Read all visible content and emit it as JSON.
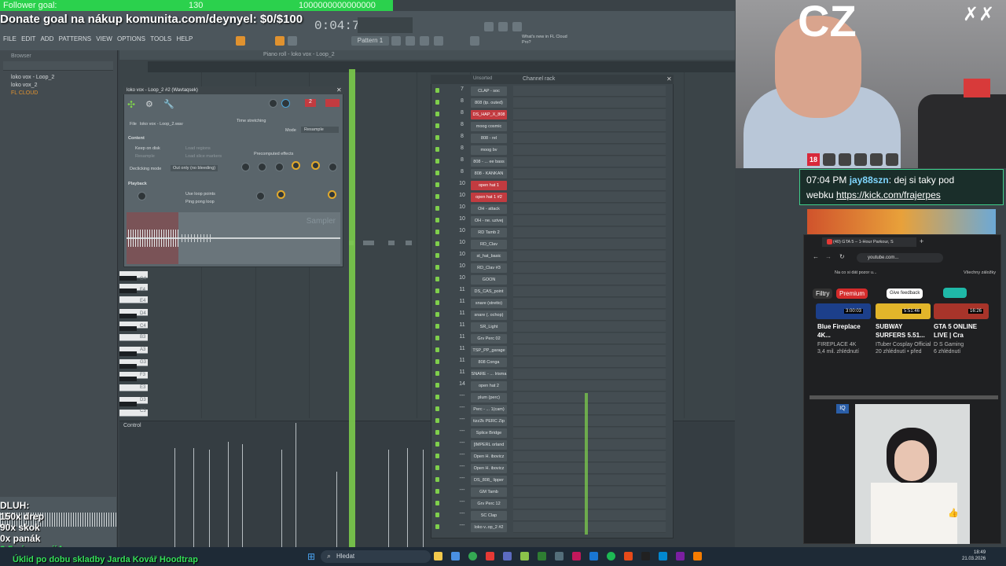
{
  "overlay": {
    "follower_goal_label": "Follower goal:",
    "follower_goal_current": "130",
    "follower_goal_target": "1000000000000000",
    "donate": "Donate goal na nákup komunita.com/deynyel: $0/$100"
  },
  "fl": {
    "menu": [
      "FILE",
      "EDIT",
      "ADD",
      "PATTERNS",
      "VIEW",
      "OPTIONS",
      "TOOLS",
      "HELP"
    ],
    "time": "0:04:76",
    "pattern": "Pattern 1",
    "hint": "What's new in FL Cloud Pro?",
    "browser_label": "Browser",
    "browser_items": [
      "loko vox - Loop_2",
      "loko vox_2",
      "FL CLOUD"
    ],
    "pianoroll_title": "Piano roll - loko vox - Loop_2",
    "control_label": "Control",
    "key_labels": [
      "G4",
      "F4",
      "E4",
      "D4",
      "C4",
      "B3",
      "A3",
      "G3",
      "F3",
      "E3",
      "D3",
      "C3"
    ]
  },
  "sampler": {
    "title": "loko vox - Loop_2 #2 (Wavtaqsek)",
    "file_label": "File",
    "file_name": "loko vox - Loop_2.wav",
    "time_stretching": "Time stretching",
    "mode_label": "Mode",
    "mode_value": "Resample",
    "content": "Content",
    "keep_on_disk": "Keep on disk",
    "load_regions": "Load regions",
    "resample": "Resample",
    "load_slice_markers": "Load slice markers",
    "declicking_label": "Declicking mode",
    "declicking_value": "Out only (no bleeding)",
    "precomputed": "Precomputed effects",
    "playback": "Playback",
    "use_loop_points": "Use loop points",
    "ping_pong": "Ping pong loop",
    "watermark": "Sampler"
  },
  "rack": {
    "title": "Channel rack",
    "filter": "Unsorted",
    "channels": [
      {
        "num": "7",
        "name": "CLAP - soc",
        "red": false
      },
      {
        "num": "8",
        "name": "808 (tp. outed)",
        "red": false
      },
      {
        "num": "8",
        "name": "DS_HAP_X_808",
        "red": true
      },
      {
        "num": "8",
        "name": "moog cosmic",
        "red": false
      },
      {
        "num": "8",
        "name": "808 - rel",
        "red": false
      },
      {
        "num": "8",
        "name": "moog bv",
        "red": false
      },
      {
        "num": "8",
        "name": "808 - ... ee bass",
        "red": false
      },
      {
        "num": "8",
        "name": "808 - KANKAN",
        "red": false
      },
      {
        "num": "10",
        "name": "open hat 1",
        "red": true
      },
      {
        "num": "10",
        "name": "open hat 1 #2",
        "red": true
      },
      {
        "num": "10",
        "name": "OH - attack",
        "red": false
      },
      {
        "num": "10",
        "name": "OH - ne. uzivej",
        "red": false
      },
      {
        "num": "10",
        "name": "RD Tamb 2",
        "red": false
      },
      {
        "num": "10",
        "name": "RD_Clav",
        "red": false
      },
      {
        "num": "10",
        "name": "st_hat_basic",
        "red": false
      },
      {
        "num": "10",
        "name": "RD_Clav #3",
        "red": false
      },
      {
        "num": "10",
        "name": "GOON",
        "red": false
      },
      {
        "num": "11",
        "name": "DS_CAS_point",
        "red": false
      },
      {
        "num": "11",
        "name": "snare (stretto)",
        "red": false
      },
      {
        "num": "11",
        "name": "snare (. ochop)",
        "red": false
      },
      {
        "num": "11",
        "name": "SR_Light",
        "red": false
      },
      {
        "num": "11",
        "name": "Grv Perc 02",
        "red": false
      },
      {
        "num": "11",
        "name": "TSP_PP_garage",
        "red": false
      },
      {
        "num": "11",
        "name": "808 Conga",
        "red": false
      },
      {
        "num": "11",
        "name": "SNARE - ... Irisma",
        "red": false
      },
      {
        "num": "14",
        "name": "open hat 2",
        "red": false
      },
      {
        "num": "---",
        "name": "plum (perc)",
        "red": false
      },
      {
        "num": "---",
        "name": "Perc - ... 1(cam)",
        "red": false
      },
      {
        "num": "---",
        "name": "tizz2k PERC Zip",
        "red": false
      },
      {
        "num": "---",
        "name": "Splice Bridge",
        "red": false
      },
      {
        "num": "---",
        "name": "[IMPERL orland",
        "red": false
      },
      {
        "num": "---",
        "name": "Open H. ibovicz",
        "red": false
      },
      {
        "num": "---",
        "name": "Open H. ibovicz",
        "red": false
      },
      {
        "num": "---",
        "name": "DS_808_ lipper",
        "red": false
      },
      {
        "num": "---",
        "name": "GM Tamb",
        "red": false
      },
      {
        "num": "---",
        "name": "Grv Perc 12",
        "red": false
      },
      {
        "num": "---",
        "name": "SC Clap",
        "red": false
      },
      {
        "num": "---",
        "name": "loko v..op_2 #2",
        "red": false
      }
    ]
  },
  "stream": {
    "channel_tag": "CZ",
    "chat_time": "07:04 PM",
    "chat_user": "jay88szn",
    "chat_text": "dej si taky pod",
    "chat_line2": "webku",
    "chat_link": "https://kick.com/frajerpes"
  },
  "chrome": {
    "tab": "(40) GTA 5 – 1-Hour Parkour, S",
    "url": "youtube.com...",
    "bookmark": "Na co si dát pozor u...",
    "bookmarks_all": "Všechny záložky",
    "filter_chip": "Filtry",
    "premium": "Premium",
    "feedback": "Give feedback",
    "videos": [
      {
        "title": "Blue Fireplace 4K...",
        "channel": "FIREPLACE 4K",
        "meta": "3,4 mil. zhlédnutí",
        "time": "3:00:03"
      },
      {
        "title": "SUBWAY SURFERS 5.51...",
        "channel": "ITuber Cosplay Official",
        "meta": "20 zhlédnutí • před",
        "time": "5:51:46"
      },
      {
        "title": "GTA 5 ONLINE LIVE | Cra",
        "channel": "D S Gaming",
        "meta": "6 zhlédnutí",
        "time": "16:26"
      }
    ]
  },
  "debt": {
    "title": "DLUH:",
    "l1": "150x drep",
    "l2": "90x skok",
    "l3": "0x panák",
    "l4": "3.5min emojiAngry",
    "l5": "Úklid po dobu skladby Jarda Kovář Hoodtrap"
  },
  "taskbar": {
    "search": "Hledat",
    "time": "18:49",
    "date": "21.03.2026"
  }
}
